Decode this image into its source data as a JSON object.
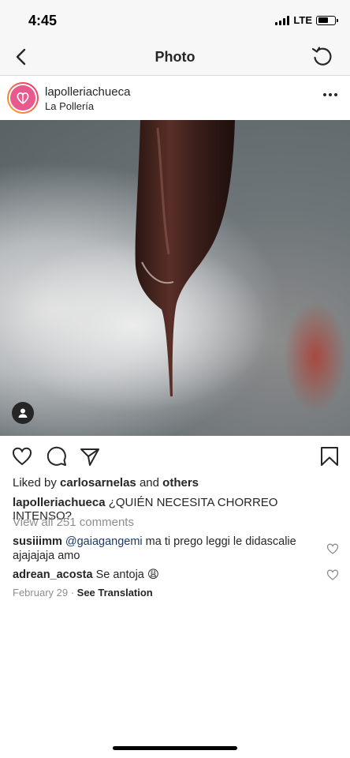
{
  "status_bar": {
    "time": "4:45",
    "network": "LTE",
    "battery_level": 0.6
  },
  "nav": {
    "title": "Photo",
    "back_icon": "chevron-left-icon",
    "refresh_icon": "refresh-icon"
  },
  "post": {
    "username": "lapolleriachueca",
    "location": "La Pollería",
    "more_icon": "more-horizontal-icon"
  },
  "actions": {
    "like_icon": "heart-outline-icon",
    "comment_icon": "comment-bubble-icon",
    "share_icon": "paper-plane-icon",
    "save_icon": "bookmark-icon"
  },
  "likes": {
    "prefix": "Liked by ",
    "user": "carlosarnelas",
    "conjunction": " and ",
    "others": "others"
  },
  "caption": {
    "username": "lapolleriachueca",
    "text": " ¿QUIÉN NECESITA CHORREO INTENSO?"
  },
  "view_all_comments": "View all 251 comments",
  "comments": [
    {
      "username": "susiiimm",
      "mention": "@gaiagangemi",
      "text": " ma ti prego leggi le didascalie ajajajaja amo"
    },
    {
      "username": "adrean_acosta",
      "text": "Se antoja 😩"
    }
  ],
  "date": "February 29",
  "separator": " · ",
  "see_translation": "See Translation",
  "colors": {
    "text": "#262626",
    "secondary_text": "#8e8e8e",
    "mention": "#1a3a6b",
    "bar_background": "#f7f7f7"
  }
}
